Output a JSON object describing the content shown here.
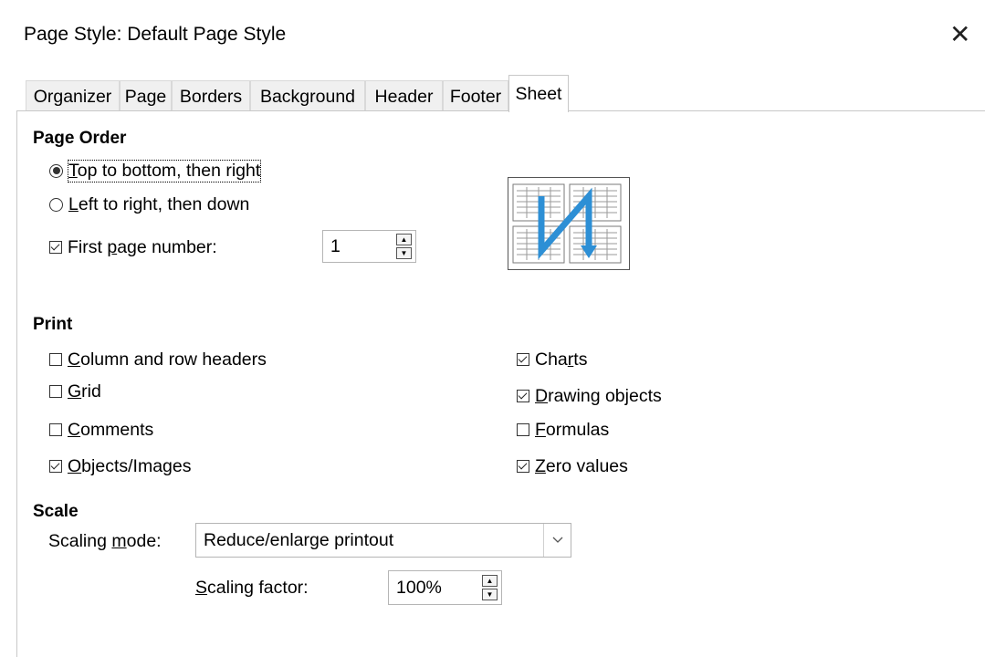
{
  "window": {
    "title": "Page Style: Default Page Style",
    "close_icon": "close-icon"
  },
  "tabs": [
    {
      "label": "Organizer",
      "active": false
    },
    {
      "label": "Page",
      "active": false
    },
    {
      "label": "Borders",
      "active": false
    },
    {
      "label": "Background",
      "active": false
    },
    {
      "label": "Header",
      "active": false
    },
    {
      "label": "Footer",
      "active": false
    },
    {
      "label": "Sheet",
      "active": true
    }
  ],
  "page_order": {
    "heading": "Page Order",
    "option_top_to_bottom": {
      "prefix": "",
      "mnemonic": "T",
      "rest": "op to bottom, then right",
      "selected": true
    },
    "option_left_to_right": {
      "prefix": "",
      "mnemonic": "L",
      "rest": "eft to right, then down",
      "selected": false
    },
    "first_page_number": {
      "prefix": "First ",
      "mnemonic": "p",
      "rest": "age number:",
      "checked": true,
      "value": "1"
    },
    "preview_icon": "page-order-preview-icon"
  },
  "print": {
    "heading": "Print",
    "column_row_headers": {
      "prefix": "",
      "mnemonic": "C",
      "rest": "olumn and row headers",
      "checked": false
    },
    "grid": {
      "prefix": "",
      "mnemonic": "G",
      "rest": "rid",
      "checked": false
    },
    "comments": {
      "prefix": "",
      "mnemonic": "C",
      "rest": "omments",
      "checked": false
    },
    "objects_images": {
      "prefix": "",
      "mnemonic": "O",
      "rest": "bjects/Images",
      "checked": true
    },
    "charts": {
      "prefix": "Cha",
      "mnemonic": "r",
      "rest": "ts",
      "checked": true
    },
    "drawing_objects": {
      "prefix": "",
      "mnemonic": "D",
      "rest": "rawing objects",
      "checked": true
    },
    "formulas": {
      "prefix": "",
      "mnemonic": "F",
      "rest": "ormulas",
      "checked": false
    },
    "zero_values": {
      "prefix": "",
      "mnemonic": "Z",
      "rest": "ero values",
      "checked": true
    }
  },
  "scale": {
    "heading": "Scale",
    "mode_label": {
      "prefix": "Scaling ",
      "mnemonic": "m",
      "rest": "ode:"
    },
    "mode_value": "Reduce/enlarge printout",
    "factor_label": {
      "prefix": "",
      "mnemonic": "S",
      "rest": "caling factor:"
    },
    "factor_value": "100%"
  },
  "colors": {
    "accent_blue": "#2d8fd5",
    "border": "#c8c8c8"
  }
}
